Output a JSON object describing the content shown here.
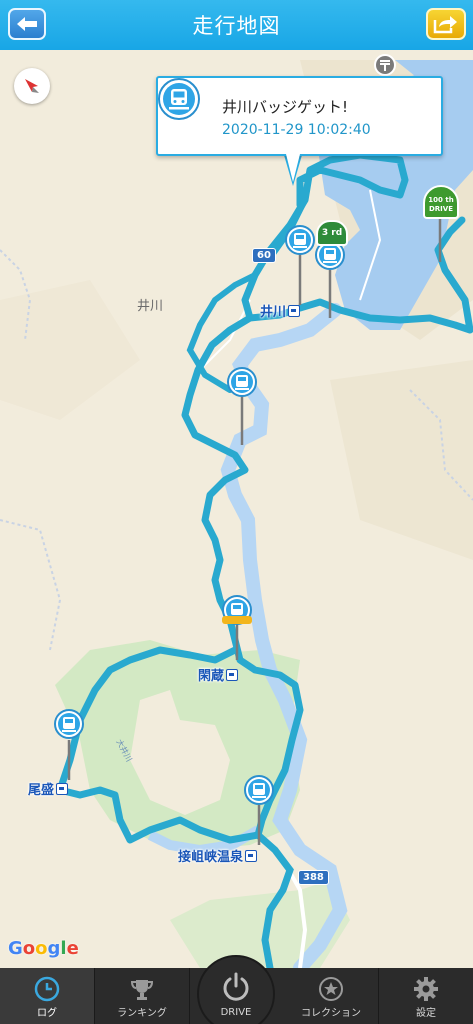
{
  "header": {
    "title": "走行地図",
    "back_icon": "arrow-left-icon",
    "share_icon": "share-arrow-icon"
  },
  "popup": {
    "title": "井川バッジゲット!",
    "timestamp": "2020-11-29 10:02:40",
    "icon": "train-badge-icon"
  },
  "map": {
    "area_name": "井川",
    "stations": [
      "井川",
      "閑蔵",
      "尾盛",
      "接岨峡温泉"
    ],
    "roads": [
      "60",
      "388"
    ],
    "river": "大井川",
    "milestones": [
      "3 rd",
      "100 th DRIVE"
    ],
    "attribution": "Google",
    "route_color": "#29a9cf",
    "water_color": "#a6ccf0"
  },
  "tabs": [
    {
      "label": "ログ",
      "icon": "clock-icon",
      "active": true
    },
    {
      "label": "ランキング",
      "icon": "trophy-icon",
      "active": false
    },
    {
      "label": "DRIVE",
      "icon": "power-icon",
      "active": false
    },
    {
      "label": "コレクション",
      "icon": "star-icon",
      "active": false
    },
    {
      "label": "設定",
      "icon": "gear-icon",
      "active": false
    }
  ]
}
